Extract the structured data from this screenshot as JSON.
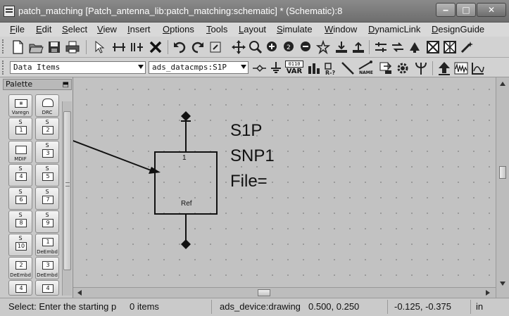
{
  "window": {
    "title": "patch_matching [Patch_antenna_lib:patch_matching:schematic] * (Schematic):8",
    "minimize": "‒",
    "maximize": "□",
    "close": "✕"
  },
  "menu": [
    "File",
    "Edit",
    "Select",
    "View",
    "Insert",
    "Options",
    "Tools",
    "Layout",
    "Simulate",
    "Window",
    "DynamicLink",
    "DesignGuide"
  ],
  "toolbar": {
    "library_combo": "Data Items",
    "component_combo": "ads_datacmps:S1P",
    "var_label_top": "0110",
    "var_label": "VAR",
    "name_label": "NAME"
  },
  "palette": {
    "title": "Palette",
    "pin": "⬒",
    "items": [
      {
        "top": "",
        "box": "Varegn",
        "caption": ""
      },
      {
        "top": "",
        "box": "",
        "caption": "DRC"
      },
      {
        "top": "S",
        "box": "1",
        "caption": ""
      },
      {
        "top": "S",
        "box": "2",
        "caption": ""
      },
      {
        "top": "",
        "box": "",
        "caption": "MDIF"
      },
      {
        "top": "S",
        "box": "3",
        "caption": ""
      },
      {
        "top": "S",
        "box": "4",
        "caption": ""
      },
      {
        "top": "S",
        "box": "5",
        "caption": ""
      },
      {
        "top": "S",
        "box": "6",
        "caption": ""
      },
      {
        "top": "S",
        "box": "7",
        "caption": ""
      },
      {
        "top": "S",
        "box": "8",
        "caption": ""
      },
      {
        "top": "S",
        "box": "9",
        "caption": ""
      },
      {
        "top": "S",
        "box": "10",
        "caption": ""
      },
      {
        "top": "",
        "box": "1",
        "caption": "DeEmbd"
      },
      {
        "top": "",
        "box": "2",
        "caption": "DeEmbd"
      },
      {
        "top": "",
        "box": "3",
        "caption": "DeEmbd"
      },
      {
        "top": "",
        "box": "4",
        "caption": ""
      },
      {
        "top": "",
        "box": "4",
        "caption": ""
      }
    ]
  },
  "component": {
    "port_number": "1",
    "ref_label": "Ref",
    "name": "S1P",
    "instance": "SNP1",
    "file_param": "File="
  },
  "statusbar": {
    "message": "Select: Enter the starting p",
    "items": "0 items",
    "context": "ads_device:drawing",
    "position": "0.500, 0.250",
    "delta": "-0.125, -0.375",
    "units": "in"
  },
  "colors": {
    "titlebar": "#7a7a7a",
    "canvas": "#c2c2c2"
  }
}
